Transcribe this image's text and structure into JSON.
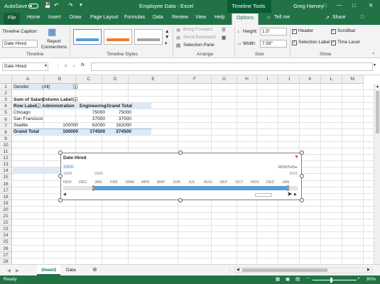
{
  "titlebar": {
    "autosave": "AutoSave",
    "doc_title": "Employee Data - Excel",
    "context_tool": "Timeline Tools",
    "user": "Greg Harvey"
  },
  "tabs": [
    "File",
    "Home",
    "Insert",
    "Draw",
    "Page Layout",
    "Formulas",
    "Data",
    "Review",
    "View",
    "Help",
    "Options"
  ],
  "tell_me": "Tell me",
  "share": "Share",
  "ribbon": {
    "timeline_caption_label": "Timeline Caption:",
    "timeline_caption_value": "Date Hired",
    "report_connections": "Report Connections",
    "group_timeline": "Timeline",
    "group_styles": "Timeline Styles",
    "bring_forward": "Bring Forward",
    "send_backward": "Send Backward",
    "selection_pane": "Selection Pane",
    "group_arrange": "Arrange",
    "height_label": "Height:",
    "height_value": "1.5\"",
    "width_label": "Width:",
    "width_value": "7.59\"",
    "group_size": "Size",
    "header": "Header",
    "scrollbar": "Scrollbar",
    "selection_label": "Selection Label",
    "time_level": "Time Level",
    "group_show": "Show"
  },
  "formula_bar": {
    "name_box": "Date Hired",
    "fx": "fx",
    "content": ""
  },
  "grid": {
    "columns": [
      "A",
      "B",
      "C",
      "D",
      "E",
      "F",
      "G",
      "H",
      "I",
      "J",
      "K",
      "L",
      "M"
    ],
    "rows": [
      "1",
      "2",
      "3",
      "4",
      "5",
      "6",
      "7",
      "8",
      "9",
      "10",
      "11",
      "12",
      "13",
      "14",
      "15",
      "16",
      "17",
      "18",
      "19",
      "20",
      "21",
      "22",
      "23",
      "24",
      "25",
      "26",
      "27",
      "28",
      "29"
    ],
    "cells": {
      "gender_label": "Gender",
      "gender_value": "(All)",
      "sum_salary": "Sum of Salary",
      "column_labels": "Column Labels",
      "row_labels": "Row Labels",
      "administration": "Administration",
      "engineering": "Engineering",
      "grand_total_hdr": "Grand Total",
      "chicago": "Chicago",
      "chicago_eng": "75000",
      "chicago_total": "75000",
      "sanfran": "San Francisco",
      "sanfran_eng": "37500",
      "sanfran_total": "37500",
      "seattle": "Seattle",
      "seattle_admin": "100000",
      "seattle_eng": "62000",
      "seattle_total": "162000",
      "grand_total": "Grand Total",
      "gt_admin": "100000",
      "gt_eng": "174500",
      "gt_total": "274500"
    }
  },
  "timeline": {
    "title": "Date Hired",
    "selection": "2000",
    "level": "MONTHS",
    "year_1999": "1999",
    "year_2000": "2000",
    "year_2001": "2001",
    "months": [
      "NOV",
      "DEC",
      "JAN",
      "FEB",
      "MAR",
      "APR",
      "MAY",
      "JUN",
      "JUL",
      "AUG",
      "SEP",
      "OCT",
      "NOV",
      "DEC",
      "JAN"
    ]
  },
  "sheets": [
    "Sheet2",
    "Data"
  ],
  "status": {
    "ready": "Ready",
    "zoom": "90%"
  }
}
